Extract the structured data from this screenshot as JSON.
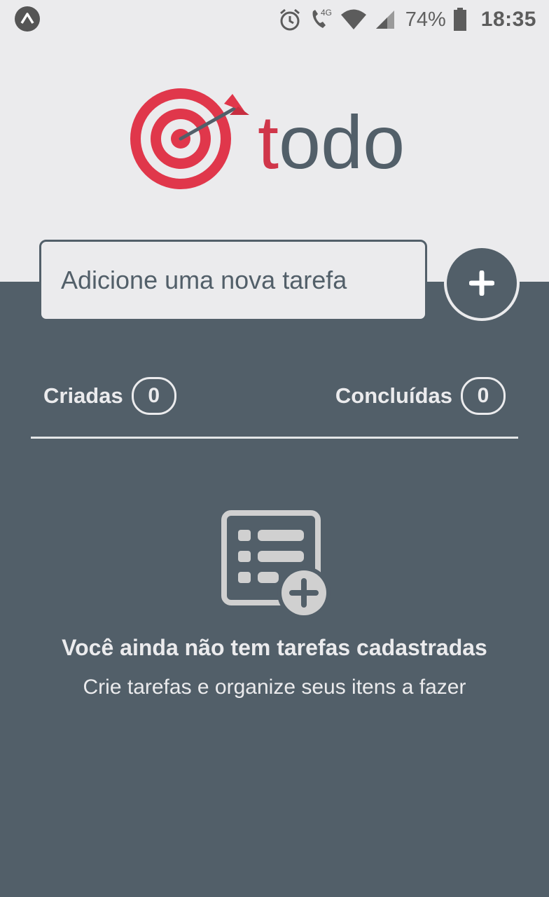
{
  "status_bar": {
    "battery_percent": "74%",
    "time": "18:35",
    "network": "4G",
    "icons": [
      "expo-icon",
      "alarm-icon",
      "volte-call-icon",
      "wifi-icon",
      "signal-icon",
      "battery-icon"
    ]
  },
  "brand": {
    "name": "todo",
    "colors": {
      "red": "#e0374b",
      "slate": "#525f69",
      "background_light": "#ebebed"
    }
  },
  "new_task": {
    "placeholder": "Adicione uma nova tarefa",
    "value": "",
    "add_icon": "plus-icon"
  },
  "counters": {
    "created_label": "Criadas",
    "created_count": "0",
    "done_label": "Concluídas",
    "done_count": "0"
  },
  "empty_state": {
    "icon": "task-list-add-icon",
    "title": "Você ainda não tem tarefas cadastradas",
    "subtitle": "Crie tarefas e organize seus itens a fazer"
  }
}
